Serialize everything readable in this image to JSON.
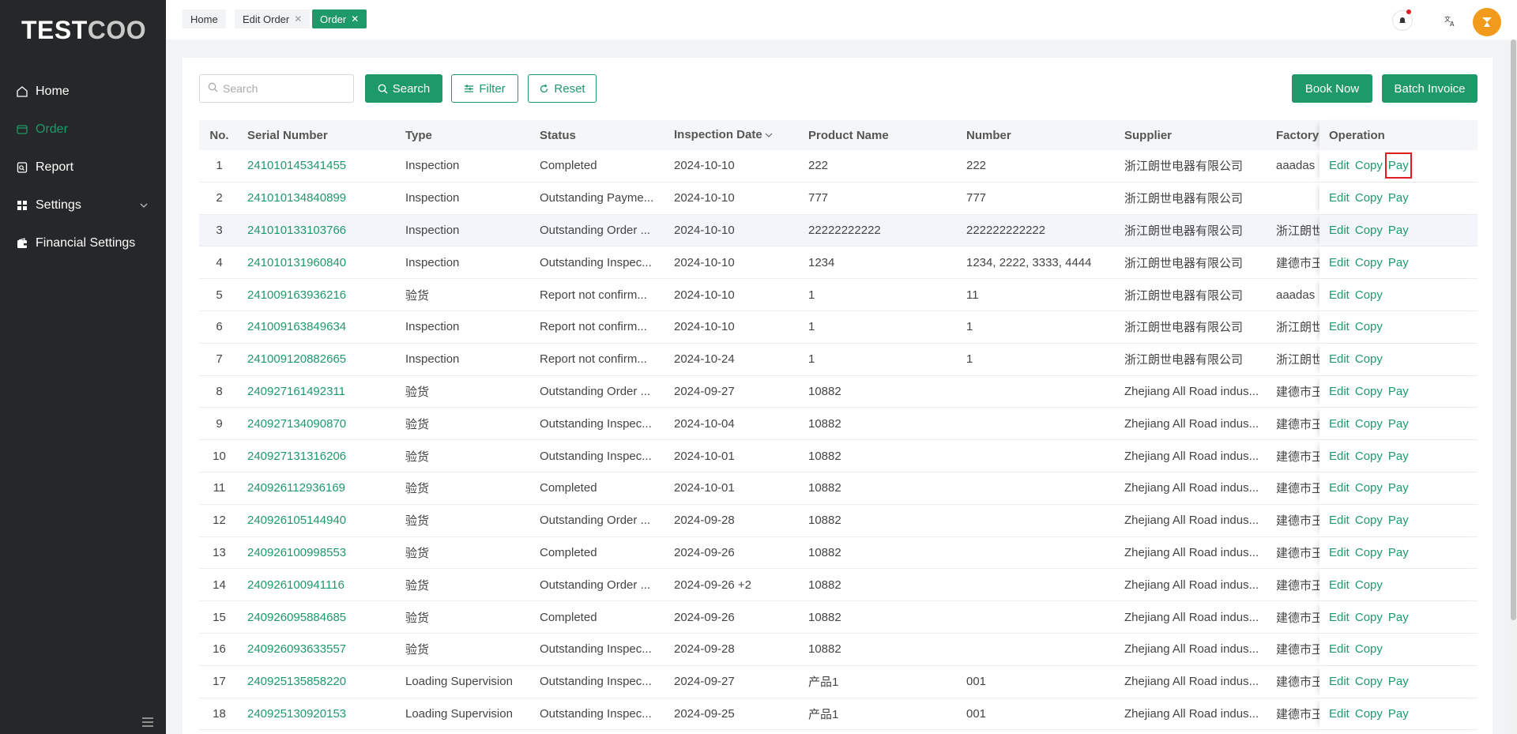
{
  "app": {
    "logo_bold": "TEST",
    "logo_light": "COO"
  },
  "sidebar": {
    "items": [
      {
        "label": "Home",
        "icon": "home-icon"
      },
      {
        "label": "Order",
        "icon": "order-icon",
        "active": true
      },
      {
        "label": "Report",
        "icon": "report-icon"
      },
      {
        "label": "Settings",
        "icon": "settings-icon",
        "expandable": true
      },
      {
        "label": "Financial Settings",
        "icon": "wallet-icon"
      }
    ]
  },
  "tabs": [
    {
      "label": "Home",
      "closable": false
    },
    {
      "label": "Edit Order",
      "closable": true
    },
    {
      "label": "Order",
      "closable": true,
      "active": true
    }
  ],
  "toolbar": {
    "search_placeholder": "Search",
    "search_label": "Search",
    "filter_label": "Filter",
    "reset_label": "Reset",
    "book_now_label": "Book Now",
    "batch_invoice_label": "Batch Invoice"
  },
  "table": {
    "headers": {
      "no": "No.",
      "serial": "Serial Number",
      "type": "Type",
      "status": "Status",
      "date": "Inspection Date",
      "product": "Product Name",
      "number": "Number",
      "supplier": "Supplier",
      "factory": "Factory",
      "operation": "Operation"
    },
    "op_labels": {
      "edit": "Edit",
      "copy": "Copy",
      "pay": "Pay"
    },
    "rows": [
      {
        "no": "1",
        "serial": "241010145341455",
        "type": "Inspection",
        "status": "Completed",
        "date": "2024-10-10",
        "product": "222",
        "number": "222",
        "supplier": "浙江朗世电器有限公司",
        "factory": "aaadas",
        "pay": true
      },
      {
        "no": "2",
        "serial": "241010134840899",
        "type": "Inspection",
        "status": "Outstanding Payme...",
        "date": "2024-10-10",
        "product": "777",
        "number": "777",
        "supplier": "浙江朗世电器有限公司",
        "factory": "",
        "pay": true
      },
      {
        "no": "3",
        "serial": "241010133103766",
        "type": "Inspection",
        "status": "Outstanding Order ...",
        "date": "2024-10-10",
        "product": "22222222222",
        "number": "222222222222",
        "supplier": "浙江朗世电器有限公司",
        "factory": "浙江朗世",
        "pay": true
      },
      {
        "no": "4",
        "serial": "241010131960840",
        "type": "Inspection",
        "status": "Outstanding Inspec...",
        "date": "2024-10-10",
        "product": "1234",
        "number": "1234, 2222, 3333, 4444",
        "supplier": "浙江朗世电器有限公司",
        "factory": "建德市王",
        "pay": true
      },
      {
        "no": "5",
        "serial": "241009163936216",
        "type": "验货",
        "status": "Report not confirm...",
        "date": "2024-10-10",
        "product": "1",
        "number": "11",
        "supplier": "浙江朗世电器有限公司",
        "factory": "aaadas",
        "pay": false
      },
      {
        "no": "6",
        "serial": "241009163849634",
        "type": "Inspection",
        "status": "Report not confirm...",
        "date": "2024-10-10",
        "product": "1",
        "number": "1",
        "supplier": "浙江朗世电器有限公司",
        "factory": "浙江朗世",
        "pay": false
      },
      {
        "no": "7",
        "serial": "241009120882665",
        "type": "Inspection",
        "status": "Report not confirm...",
        "date": "2024-10-24",
        "product": "1",
        "number": "1",
        "supplier": "浙江朗世电器有限公司",
        "factory": "浙江朗世",
        "pay": false
      },
      {
        "no": "8",
        "serial": "240927161492311",
        "type": "验货",
        "status": "Outstanding Order ...",
        "date": "2024-09-27",
        "product": "10882",
        "number": "",
        "supplier": "Zhejiang All Road indus...",
        "factory": "建德市王",
        "pay": true
      },
      {
        "no": "9",
        "serial": "240927134090870",
        "type": "验货",
        "status": "Outstanding Inspec...",
        "date": "2024-10-04",
        "product": "10882",
        "number": "",
        "supplier": "Zhejiang All Road indus...",
        "factory": "建德市王",
        "pay": true
      },
      {
        "no": "10",
        "serial": "240927131316206",
        "type": "验货",
        "status": "Outstanding Inspec...",
        "date": "2024-10-01",
        "product": "10882",
        "number": "",
        "supplier": "Zhejiang All Road indus...",
        "factory": "建德市王",
        "pay": true
      },
      {
        "no": "11",
        "serial": "240926112936169",
        "type": "验货",
        "status": "Completed",
        "date": "2024-10-01",
        "product": "10882",
        "number": "",
        "supplier": "Zhejiang All Road indus...",
        "factory": "建德市王",
        "pay": true
      },
      {
        "no": "12",
        "serial": "240926105144940",
        "type": "验货",
        "status": "Outstanding Order ...",
        "date": "2024-09-28",
        "product": "10882",
        "number": "",
        "supplier": "Zhejiang All Road indus...",
        "factory": "建德市王",
        "pay": true
      },
      {
        "no": "13",
        "serial": "240926100998553",
        "type": "验货",
        "status": "Completed",
        "date": "2024-09-26",
        "product": "10882",
        "number": "",
        "supplier": "Zhejiang All Road indus...",
        "factory": "建德市王",
        "pay": true
      },
      {
        "no": "14",
        "serial": "240926100941116",
        "type": "验货",
        "status": "Outstanding Order ...",
        "date": "2024-09-26 +2",
        "product": "10882",
        "number": "",
        "supplier": "Zhejiang All Road indus...",
        "factory": "建德市王",
        "pay": false
      },
      {
        "no": "15",
        "serial": "240926095884685",
        "type": "验货",
        "status": "Completed",
        "date": "2024-09-26",
        "product": "10882",
        "number": "",
        "supplier": "Zhejiang All Road indus...",
        "factory": "建德市王",
        "pay": true
      },
      {
        "no": "16",
        "serial": "240926093633557",
        "type": "验货",
        "status": "Outstanding Inspec...",
        "date": "2024-09-28",
        "product": "10882",
        "number": "",
        "supplier": "Zhejiang All Road indus...",
        "factory": "建德市王",
        "pay": false
      },
      {
        "no": "17",
        "serial": "240925135858220",
        "type": "Loading Supervision",
        "status": "Outstanding Inspec...",
        "date": "2024-09-27",
        "product": "产品1",
        "number": "001",
        "supplier": "Zhejiang All Road indus...",
        "factory": "建德市王",
        "pay": true
      },
      {
        "no": "18",
        "serial": "240925130920153",
        "type": "Loading Supervision",
        "status": "Outstanding Inspec...",
        "date": "2024-09-25",
        "product": "产品1",
        "number": "001",
        "supplier": "Zhejiang All Road indus...",
        "factory": "建德市王",
        "pay": true
      }
    ]
  },
  "colors": {
    "accent": "#1e9a6a",
    "sidebar_bg": "#262729",
    "highlight_box": "#e02020",
    "avatar": "#f29a1c"
  }
}
